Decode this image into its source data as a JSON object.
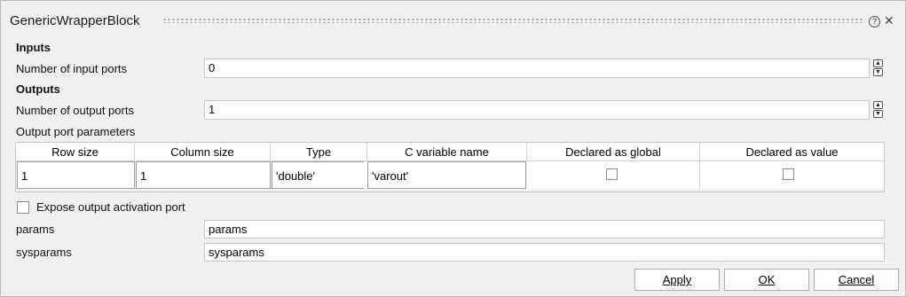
{
  "window": {
    "title": "GenericWrapperBlock",
    "help_icon": "?",
    "close_icon": "✕"
  },
  "inputs": {
    "section": "Inputs",
    "num_ports_label": "Number of input ports",
    "num_ports_value": "0"
  },
  "outputs": {
    "section": "Outputs",
    "num_ports_label": "Number of output ports",
    "num_ports_value": "1",
    "params_label": "Output port parameters",
    "columns": [
      "Row size",
      "Column size",
      "Type",
      "C variable name",
      "Declared as global",
      "Declared as value"
    ],
    "rows": [
      {
        "row_size": "1",
        "column_size": "1",
        "type": "'double'",
        "c_variable": "'varout'",
        "global": false,
        "value": false
      }
    ]
  },
  "expose": {
    "label": "Expose output activation port",
    "checked": false
  },
  "params": {
    "label": "params",
    "value": "params"
  },
  "sysparams": {
    "label": "sysparams",
    "value": "sysparams"
  },
  "buttons": {
    "apply": "Apply",
    "ok": "OK",
    "cancel": "Cancel"
  }
}
